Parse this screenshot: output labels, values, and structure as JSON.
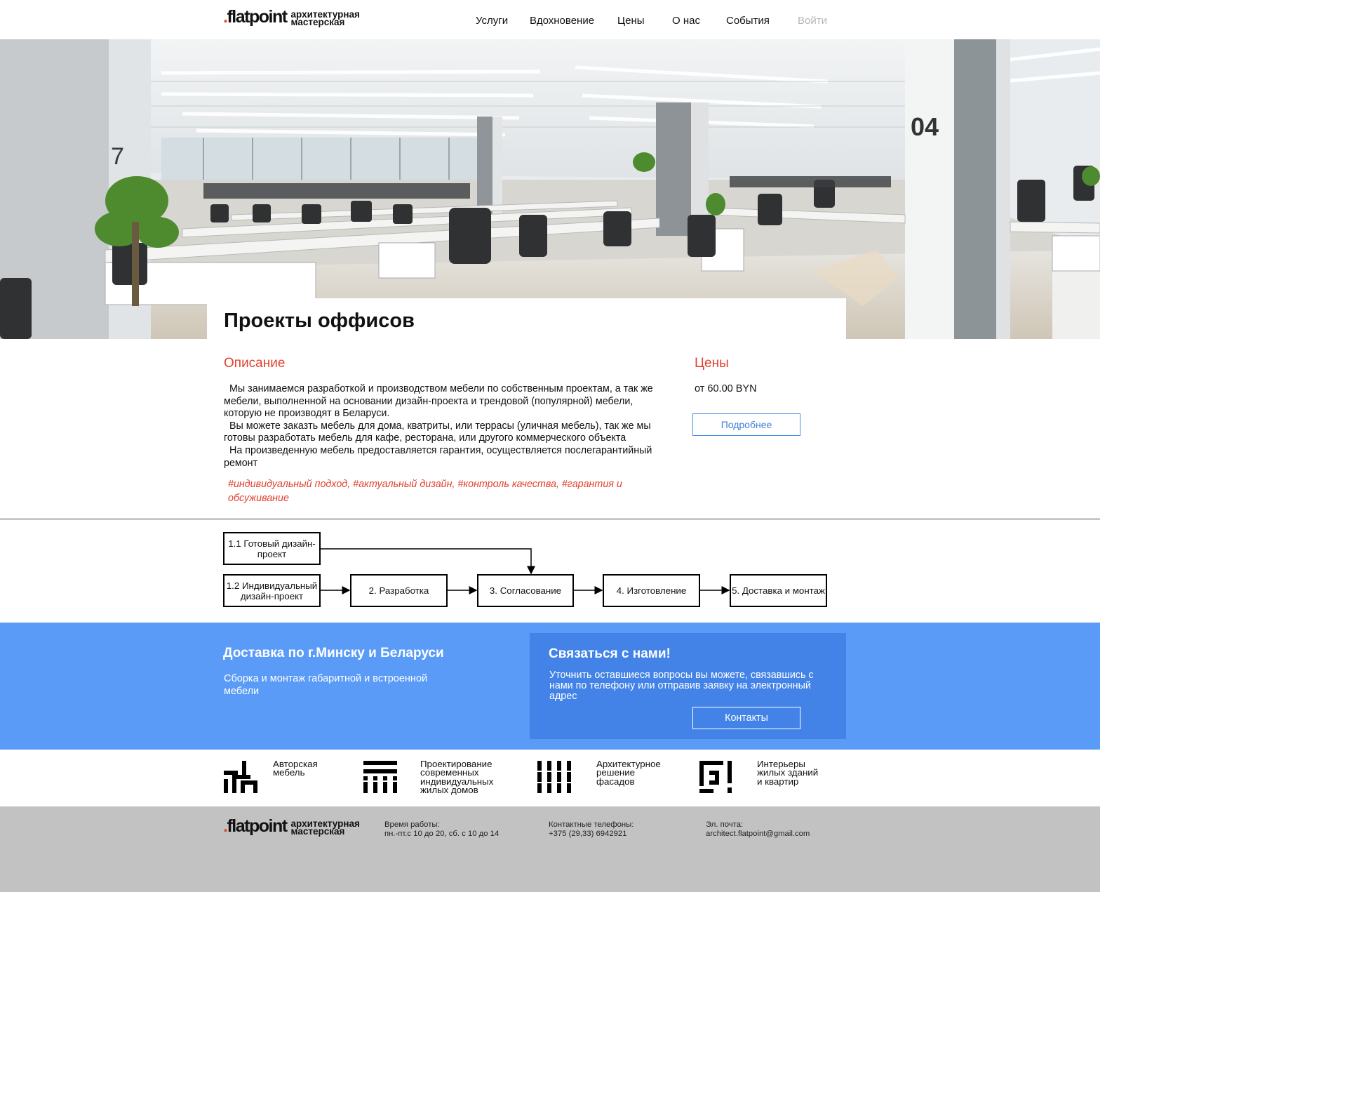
{
  "header": {
    "logo_mark": "flatpoint",
    "logo_line1": "архитектурная",
    "logo_line2": "мастерская",
    "nav": [
      "Услуги",
      "Вдохновение",
      "Цены",
      "О нас",
      "События"
    ],
    "login": "Войти"
  },
  "hero": {
    "title": "Проекты оффисов",
    "column_label_left": "7",
    "column_label_right": "04"
  },
  "description": {
    "heading": "Описание",
    "paragraphs": [
      "Мы занимаемся разработкой и производством мебели по собственным проектам, а так же мебели, выполненной на основании дизайн-проекта и трендовой (популярной) мебели, которую не производят в Беларуси.",
      "Вы можете заказть мебель для дома, кватриты, или террасы (уличная мебель), так же мы готовы разработать мебель для кафе, ресторана, или другого коммерческого объекта",
      "На произведенную мебель предоставляется гарантия, осуществляется послегарантийный ремонт"
    ],
    "tags": "#индивидуальный подход, #актуальный дизайн, #контроль качества, #гарантия и обсуживание"
  },
  "prices": {
    "heading": "Цены",
    "value": "от 60.00 BYN",
    "button": "Подробнее"
  },
  "flow": {
    "steps": [
      "1.1 Готовый дизайн-проект",
      "1.2 Индивидуальный дизайн-проект",
      "2. Разработка",
      "3. Согласование",
      "4. Изготовление",
      "5. Доставка и монтаж"
    ]
  },
  "delivery": {
    "title": "Доставка по г.Минску и Беларуси",
    "text": "Сборка и монтаж габаритной и встроенной мебели"
  },
  "contact": {
    "title": "Связаться с нами!",
    "text": "Уточнить оставшиеся вопросы вы можете, связавшись с нами по телефону или отправив заявку на электронный адрес",
    "button": "Контакты"
  },
  "features": [
    {
      "icon": "author-furniture-icon",
      "lines": [
        "Авторская",
        "мебель"
      ]
    },
    {
      "icon": "private-houses-icon",
      "lines": [
        "Проектирование",
        "современных",
        "индивидуальных",
        "жилых домов"
      ]
    },
    {
      "icon": "facades-icon",
      "lines": [
        "Архитектурное",
        "решение",
        "фасадов"
      ]
    },
    {
      "icon": "interiors-icon",
      "lines": [
        "Интерьеры",
        "жилых зданий",
        "и квартир"
      ]
    }
  ],
  "footer": {
    "hours_label": "Время работы:",
    "hours_value": "пн.-пт.с 10 до 20, сб. с 10 до 14",
    "phones_label": "Контактные телефоны:",
    "phones_value": "+375 (29,33) 6942921",
    "email_label": "Эл. почта:",
    "email_value": "architect.flatpoint@gmail.com"
  },
  "colors": {
    "accent": "#e2402e",
    "band": "#5a9bf8",
    "contact_box": "#4383e8",
    "button_text": "#3f7fd8",
    "footer_bg": "#c2c2c2"
  }
}
